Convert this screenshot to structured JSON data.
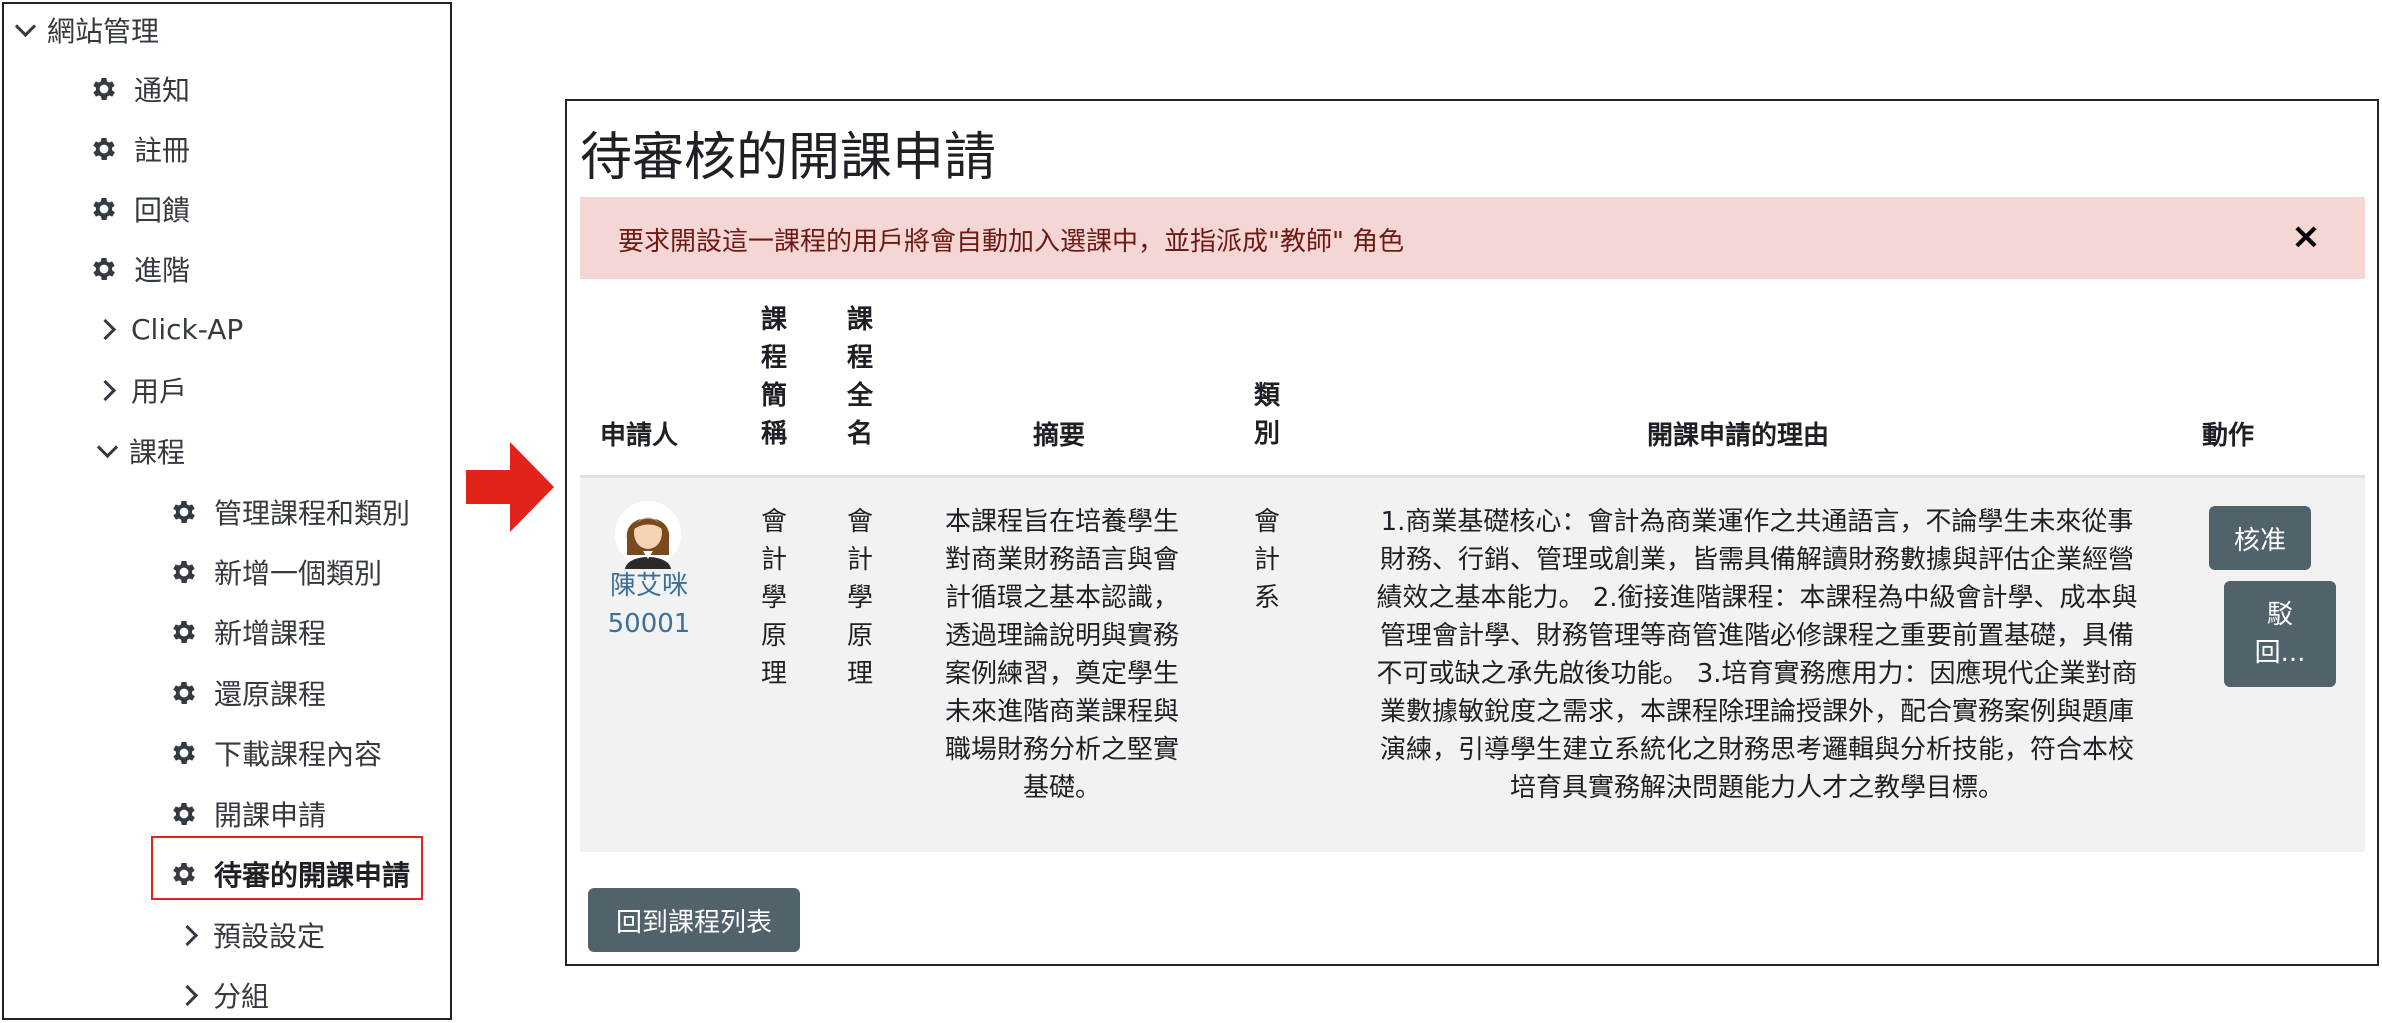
{
  "nav": {
    "root": "網站管理",
    "items": [
      {
        "label": "通知",
        "icon": "gear-icon"
      },
      {
        "label": "註冊",
        "icon": "gear-icon"
      },
      {
        "label": "回饋",
        "icon": "gear-icon"
      },
      {
        "label": "進階",
        "icon": "gear-icon"
      }
    ],
    "groups": [
      {
        "label": "Click-AP",
        "icon": "chevron-right-icon"
      },
      {
        "label": "用戶",
        "icon": "chevron-right-icon"
      },
      {
        "label": "課程",
        "icon": "chevron-down-icon"
      }
    ],
    "course_items": [
      {
        "label": "管理課程和類別",
        "icon": "gear-icon"
      },
      {
        "label": "新增一個類別",
        "icon": "gear-icon"
      },
      {
        "label": "新增課程",
        "icon": "gear-icon"
      },
      {
        "label": "還原課程",
        "icon": "gear-icon"
      },
      {
        "label": "下載課程內容",
        "icon": "gear-icon"
      },
      {
        "label": "開課申請",
        "icon": "gear-icon"
      },
      {
        "label": "待審的開課申請",
        "icon": "gear-icon",
        "active": true
      }
    ],
    "sub_groups": [
      {
        "label": "預設設定",
        "icon": "chevron-right-icon"
      },
      {
        "label": "分組",
        "icon": "chevron-right-icon"
      }
    ]
  },
  "main": {
    "title": "待審核的開課申請",
    "alert": "要求開設這一課程的用戶將會自動加入選課中，並指派成\"教師\" 角色",
    "alert_close": "×",
    "columns": {
      "applicant": "申請人",
      "short_name": "課程簡稱",
      "full_name": "課程全名",
      "summary": "摘要",
      "category": "類別",
      "reason": "開課申請的理由",
      "actions": "動作"
    },
    "rows": [
      {
        "applicant_name": "陳艾咪",
        "applicant_id": "50001",
        "short_name": "會計學原理",
        "full_name": "會計學原理",
        "summary_lines": [
          "本課程旨在培養學生",
          "對商業財務語言與會",
          "計循環之基本認識，",
          "透過理論說明與實務",
          "案例練習，奠定學生",
          "未來進階商業課程與",
          "職場財務分析之堅實",
          "基礎。"
        ],
        "category": "會計系",
        "reason_lines": [
          "1.商業基礎核心：會計為商業運作之共通語言，不論學生未來從事",
          "財務、行銷、管理或創業，皆需具備解讀財務數據與評估企業經營",
          "績效之基本能力。 2.銜接進階課程：本課程為中級會計學、成本與",
          "管理會計學、財務管理等商管進階必修課程之重要前置基礎，具備",
          "不可或缺之承先啟後功能。 3.培育實務應用力：因應現代企業對商",
          "業數據敏銳度之需求，本課程除理論授課外，配合實務案例與題庫",
          "演練，引導學生建立系統化之財務思考邏輯與分析技能，符合本校",
          "培育具實務解決問題能力人才之教學目標。"
        ],
        "approve_label": "核准",
        "reject_label_lines": [
          "駁",
          "回..."
        ]
      }
    ],
    "back_button": "回到課程列表"
  },
  "colors": {
    "accent_red": "#e2231a",
    "button": "#52626b",
    "alert_bg": "#f4d6d5",
    "alert_text": "#6e1a13",
    "link": "#3a6f99"
  }
}
